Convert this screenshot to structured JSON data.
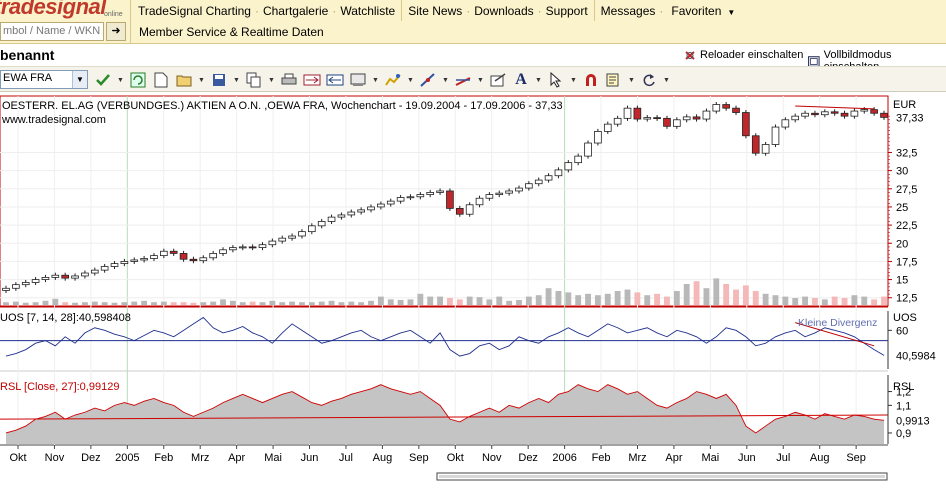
{
  "logo": {
    "text": "tradesignal",
    "sub": "online"
  },
  "menu": {
    "group1": [
      "TradeSignal Charting",
      "Chartgalerie",
      "Watchliste"
    ],
    "group2": [
      "Site News",
      "Downloads",
      "Support"
    ],
    "group3": [
      "Messages",
      "Favoriten"
    ]
  },
  "search": {
    "placeholder": "mbol / Name / WKN"
  },
  "member_link": "Member Service & Realtime Daten",
  "workspace": {
    "title": "benannt",
    "reload_label": "Reloader einschalten",
    "fullscreen_label": "Vollbildmodus einschalten"
  },
  "toolbar": {
    "symbol_value": "EWA FRA"
  },
  "icons": [
    "check-icon",
    "refresh-icon",
    "new-document-icon",
    "open-folder-icon",
    "save-icon",
    "copy-icon",
    "print-icon",
    "link-icon",
    "window-icon",
    "drawing-icon",
    "indicator-icon",
    "trendline-icon",
    "properties-icon",
    "text-tool-icon",
    "pointer-icon",
    "magnet-icon",
    "settings-icon",
    "redo-icon"
  ],
  "colors": {
    "topbar": "#fbf3cc",
    "border_red": "#c00000",
    "up_candle": "#ffffff",
    "down_candle": "#c0272d",
    "uos_line": "#1f2f8f",
    "rsl_fill": "#c0c0c0",
    "rsl_line": "#d00000"
  },
  "price_panel": {
    "title": "OESTERR. EL.AG (VERBUNDGES.) AKTIEN A O.N. ,OEWA FRA, Wochenchart - 19.09.2004 - 17.09.2006 - 37,33",
    "source": "www.tradesignal.com",
    "currency": "EUR",
    "last_value": "37,33",
    "y_ticks": [
      "32,5",
      "30",
      "27,5",
      "25",
      "22,5",
      "20",
      "17,5",
      "15",
      "12,5"
    ]
  },
  "uos_panel": {
    "label": "UOS [7, 14, 28]:40,598408",
    "axis_label": "UOS",
    "last_value": "40,5984",
    "y_ticks": [
      "60"
    ],
    "annotation": "Kleine Divergenz"
  },
  "rsl_panel": {
    "label": "RSL [Close, 27]:0,99129",
    "axis_label": "RSL",
    "last_value": "0,9913",
    "y_ticks": [
      "1,2",
      "1,1",
      "0,9"
    ]
  },
  "x_axis": [
    "Okt",
    "Nov",
    "Dez",
    "2005",
    "Feb",
    "Mrz",
    "Apr",
    "Mai",
    "Jun",
    "Jul",
    "Aug",
    "Sep",
    "Okt",
    "Nov",
    "Dez",
    "2006",
    "Feb",
    "Mrz",
    "Apr",
    "Mai",
    "Jun",
    "Jul",
    "Aug",
    "Sep"
  ],
  "chart_data": {
    "type": "candlestick",
    "title": "OESTERR. EL.AG (VERBUNDGES.) AKTIEN A O.N. ,OEWA FRA, Wochenchart - 19.09.2004 - 17.09.2006 - 37,33",
    "x_range": [
      "2004-09-19",
      "2006-09-17"
    ],
    "ylabel": "EUR",
    "ylim": [
      11.5,
      40
    ],
    "weekly_close": [
      13.8,
      14.3,
      14.6,
      15.0,
      15.3,
      15.6,
      15.2,
      15.5,
      15.9,
      16.3,
      16.8,
      17.2,
      17.5,
      17.7,
      17.9,
      18.3,
      18.9,
      18.6,
      17.8,
      17.6,
      18.0,
      18.6,
      19.1,
      19.4,
      19.5,
      19.4,
      19.8,
      20.3,
      20.7,
      21.0,
      21.6,
      22.4,
      23.0,
      23.6,
      23.9,
      24.3,
      24.6,
      25.0,
      25.4,
      25.8,
      26.3,
      26.4,
      26.7,
      27.0,
      27.2,
      24.8,
      24.0,
      25.3,
      26.2,
      26.7,
      26.9,
      27.2,
      27.6,
      28.2,
      28.7,
      29.3,
      30.1,
      31.1,
      32.0,
      33.8,
      35.4,
      36.4,
      37.2,
      38.6,
      37.1,
      37.3,
      37.2,
      36.1,
      37.0,
      37.4,
      37.1,
      38.2,
      39.1,
      38.6,
      38.0,
      34.8,
      32.4,
      33.6,
      36.0,
      37.0,
      37.5,
      37.9,
      37.7,
      38.1,
      37.9,
      37.5,
      38.2,
      38.4,
      37.9,
      37.33
    ],
    "volume_relative": [
      0.1,
      0.12,
      0.08,
      0.1,
      0.15,
      0.22,
      0.1,
      0.08,
      0.1,
      0.12,
      0.1,
      0.08,
      0.1,
      0.12,
      0.15,
      0.1,
      0.12,
      0.1,
      0.1,
      0.08,
      0.1,
      0.12,
      0.2,
      0.15,
      0.1,
      0.12,
      0.1,
      0.15,
      0.1,
      0.12,
      0.1,
      0.1,
      0.12,
      0.15,
      0.1,
      0.12,
      0.1,
      0.15,
      0.3,
      0.2,
      0.18,
      0.2,
      0.4,
      0.3,
      0.3,
      0.25,
      0.2,
      0.3,
      0.28,
      0.2,
      0.3,
      0.15,
      0.18,
      0.3,
      0.35,
      0.6,
      0.5,
      0.45,
      0.35,
      0.4,
      0.35,
      0.4,
      0.5,
      0.55,
      0.45,
      0.35,
      0.4,
      0.3,
      0.5,
      0.75,
      0.85,
      0.6,
      0.95,
      0.75,
      0.55,
      0.7,
      0.5,
      0.4,
      0.35,
      0.3,
      0.25,
      0.3,
      0.25,
      0.2,
      0.3,
      0.25,
      0.35,
      0.3,
      0.2,
      0.3
    ],
    "uos": [
      40,
      42,
      45,
      50,
      52,
      48,
      55,
      50,
      58,
      62,
      60,
      57,
      55,
      52,
      56,
      60,
      58,
      55,
      60,
      65,
      70,
      62,
      58,
      60,
      63,
      58,
      55,
      50,
      58,
      65,
      60,
      55,
      50,
      52,
      55,
      58,
      60,
      55,
      52,
      55,
      58,
      60,
      55,
      50,
      58,
      45,
      40,
      42,
      48,
      50,
      45,
      48,
      55,
      52,
      50,
      55,
      58,
      62,
      58,
      55,
      60,
      65,
      62,
      58,
      60,
      62,
      58,
      55,
      60,
      58,
      55,
      50,
      55,
      62,
      60,
      55,
      48,
      50,
      55,
      58,
      60,
      55,
      58,
      62,
      60,
      58,
      55,
      50,
      45,
      40.6
    ],
    "rsl": [
      0.9,
      0.92,
      0.95,
      1.0,
      1.02,
      1.05,
      1.0,
      1.03,
      1.05,
      1.08,
      1.06,
      1.1,
      1.12,
      1.1,
      1.13,
      1.15,
      1.12,
      1.1,
      1.05,
      1.02,
      1.05,
      1.08,
      1.12,
      1.15,
      1.18,
      1.15,
      1.12,
      1.15,
      1.18,
      1.2,
      1.16,
      1.12,
      1.1,
      1.13,
      1.15,
      1.18,
      1.2,
      1.22,
      1.25,
      1.22,
      1.2,
      1.18,
      1.2,
      1.15,
      1.1,
      1.0,
      0.98,
      1.02,
      1.05,
      1.08,
      1.05,
      1.1,
      1.08,
      1.12,
      1.15,
      1.12,
      1.18,
      1.2,
      1.25,
      1.22,
      1.2,
      1.25,
      1.22,
      1.18,
      1.2,
      1.15,
      1.1,
      1.08,
      1.12,
      1.15,
      1.2,
      1.18,
      1.15,
      1.18,
      1.1,
      0.95,
      0.9,
      0.95,
      1.0,
      1.02,
      1.05,
      1.03,
      1.0,
      1.04,
      1.02,
      1.0,
      1.03,
      1.02,
      1.0,
      0.9913
    ],
    "divergence_line_price": [
      38.9,
      38.5
    ],
    "divergence_line_uos": [
      66,
      48
    ]
  }
}
